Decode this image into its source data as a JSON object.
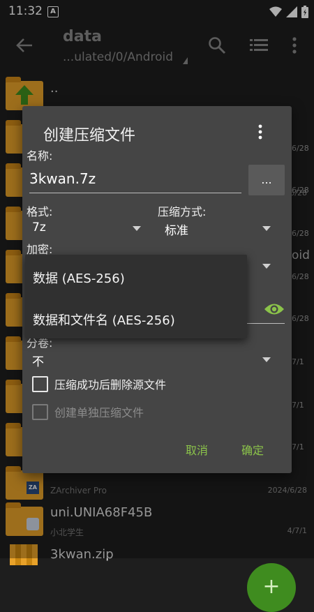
{
  "status": {
    "time": "11:32",
    "notif_icon_letter": "A"
  },
  "toolbar": {
    "title": "data",
    "path": "...ulated/0/Android"
  },
  "background": {
    "dates": [
      "6/28",
      "6/28",
      "6/28",
      "6/28",
      "6/28",
      "7/1",
      "7/1",
      "7/1",
      "7/1"
    ],
    "partial_text": "oid",
    "rows": [
      {
        "name": "..",
        "sub": ""
      },
      {
        "name": "",
        "sub": "ZArchiver Pro",
        "date": "2024/6/28"
      },
      {
        "name": "uni.UNIA68F45B",
        "sub": "小北学生",
        "date": "4/7/1"
      },
      {
        "name": "3kwan.zip",
        "sub": ""
      }
    ]
  },
  "dialog": {
    "title": "创建压缩文件",
    "name_label": "名称:",
    "name_value": "3kwan.7z",
    "browse_label": "...",
    "format_label": "格式:",
    "format_value": "7z",
    "method_label": "压缩方式:",
    "method_value": "标准",
    "encrypt_label": "加密:",
    "split_label": "分卷:",
    "split_value": "不",
    "delete_source_label": "压缩成功后删除源文件",
    "separate_archive_label": "创建单独压缩文件",
    "cancel_label": "取消",
    "ok_label": "确定"
  },
  "popup": {
    "options": [
      "数据 (AES-256)",
      "数据和文件名 (AES-256)"
    ]
  },
  "colors": {
    "accent": "#8bc34a",
    "folder": "#e8a22a",
    "fab": "#3f8c1f",
    "dialog_bg": "#454545"
  }
}
